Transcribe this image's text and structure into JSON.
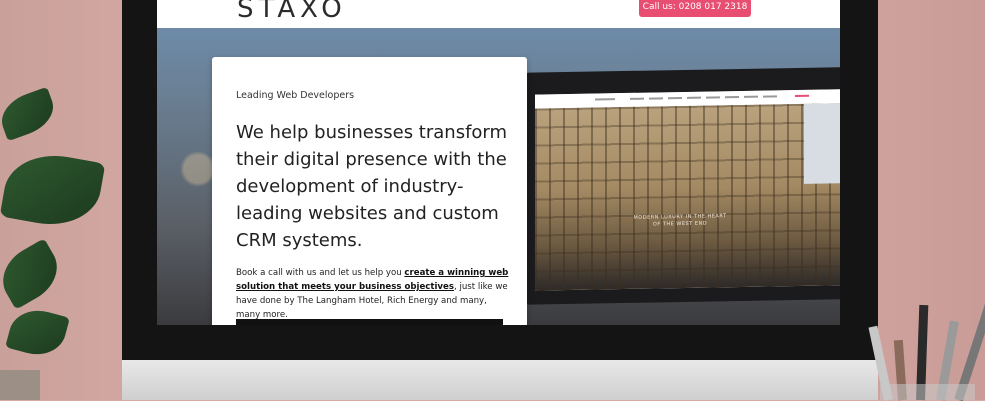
{
  "site": {
    "logo": "STAXO",
    "call_label": "Call us: 0208 017 2318"
  },
  "hero": {
    "eyebrow": "Leading Web Developers",
    "headline": "We help businesses transform their digital presence with the development of industry-leading websites and custom CRM systems.",
    "body_prefix": "Book a call with us and let us help you ",
    "body_link": "create a winning web solution that meets your business objectives",
    "body_suffix": ", just like we have done by The Langham Hotel, Rich Energy and many, many more."
  },
  "mockup": {
    "caption_line1": "MODERN LUXURY IN THE HEART",
    "caption_line2": "OF THE WEST END"
  },
  "colors": {
    "accent": "#e84e72",
    "wall": "#d8aba6"
  }
}
